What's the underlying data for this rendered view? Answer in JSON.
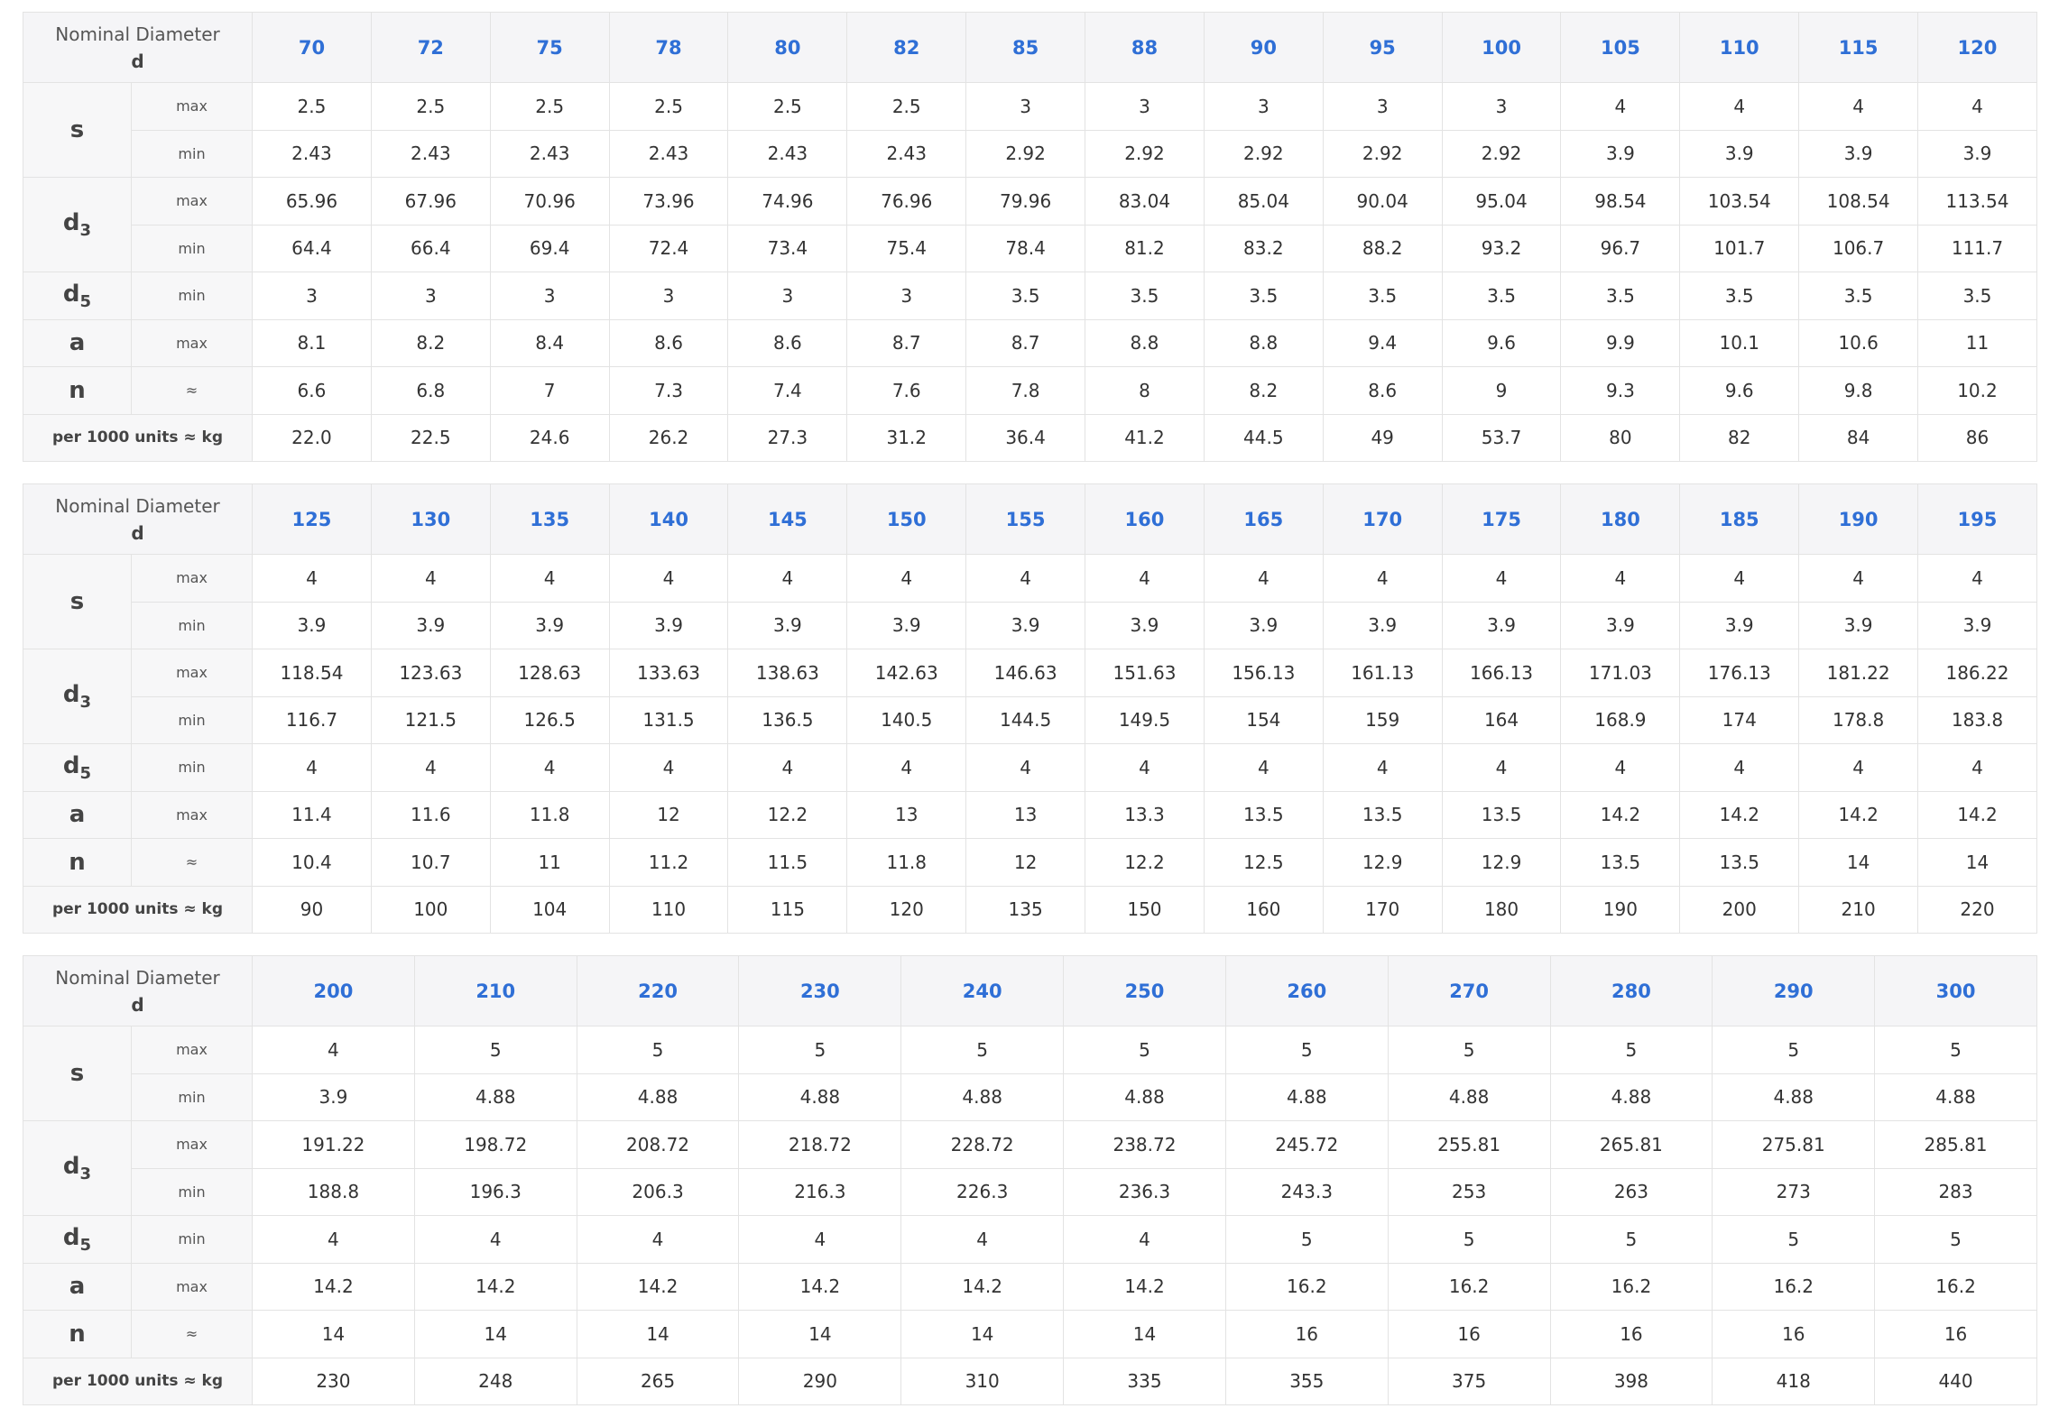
{
  "labels": {
    "nominal_line1": "Nominal Diameter",
    "nominal_line2": "d",
    "weight": "per 1000 units ≈ kg"
  },
  "params": [
    {
      "base": "s",
      "sub": "",
      "rows": [
        "max",
        "min"
      ]
    },
    {
      "base": "d",
      "sub": "3",
      "rows": [
        "max",
        "min"
      ]
    },
    {
      "base": "d",
      "sub": "5",
      "rows": [
        "min"
      ]
    },
    {
      "base": "a",
      "sub": "",
      "rows": [
        "max"
      ]
    },
    {
      "base": "n",
      "sub": "",
      "rows": [
        "≈"
      ]
    }
  ],
  "tables": [
    {
      "sizes": [
        "70",
        "72",
        "75",
        "78",
        "80",
        "82",
        "85",
        "88",
        "90",
        "95",
        "100",
        "105",
        "110",
        "115",
        "120"
      ],
      "rows": [
        [
          "2.5",
          "2.5",
          "2.5",
          "2.5",
          "2.5",
          "2.5",
          "3",
          "3",
          "3",
          "3",
          "3",
          "4",
          "4",
          "4",
          "4"
        ],
        [
          "2.43",
          "2.43",
          "2.43",
          "2.43",
          "2.43",
          "2.43",
          "2.92",
          "2.92",
          "2.92",
          "2.92",
          "2.92",
          "3.9",
          "3.9",
          "3.9",
          "3.9"
        ],
        [
          "65.96",
          "67.96",
          "70.96",
          "73.96",
          "74.96",
          "76.96",
          "79.96",
          "83.04",
          "85.04",
          "90.04",
          "95.04",
          "98.54",
          "103.54",
          "108.54",
          "113.54"
        ],
        [
          "64.4",
          "66.4",
          "69.4",
          "72.4",
          "73.4",
          "75.4",
          "78.4",
          "81.2",
          "83.2",
          "88.2",
          "93.2",
          "96.7",
          "101.7",
          "106.7",
          "111.7"
        ],
        [
          "3",
          "3",
          "3",
          "3",
          "3",
          "3",
          "3.5",
          "3.5",
          "3.5",
          "3.5",
          "3.5",
          "3.5",
          "3.5",
          "3.5",
          "3.5"
        ],
        [
          "8.1",
          "8.2",
          "8.4",
          "8.6",
          "8.6",
          "8.7",
          "8.7",
          "8.8",
          "8.8",
          "9.4",
          "9.6",
          "9.9",
          "10.1",
          "10.6",
          "11"
        ],
        [
          "6.6",
          "6.8",
          "7",
          "7.3",
          "7.4",
          "7.6",
          "7.8",
          "8",
          "8.2",
          "8.6",
          "9",
          "9.3",
          "9.6",
          "9.8",
          "10.2"
        ],
        [
          "22.0",
          "22.5",
          "24.6",
          "26.2",
          "27.3",
          "31.2",
          "36.4",
          "41.2",
          "44.5",
          "49",
          "53.7",
          "80",
          "82",
          "84",
          "86"
        ]
      ]
    },
    {
      "sizes": [
        "125",
        "130",
        "135",
        "140",
        "145",
        "150",
        "155",
        "160",
        "165",
        "170",
        "175",
        "180",
        "185",
        "190",
        "195"
      ],
      "rows": [
        [
          "4",
          "4",
          "4",
          "4",
          "4",
          "4",
          "4",
          "4",
          "4",
          "4",
          "4",
          "4",
          "4",
          "4",
          "4"
        ],
        [
          "3.9",
          "3.9",
          "3.9",
          "3.9",
          "3.9",
          "3.9",
          "3.9",
          "3.9",
          "3.9",
          "3.9",
          "3.9",
          "3.9",
          "3.9",
          "3.9",
          "3.9"
        ],
        [
          "118.54",
          "123.63",
          "128.63",
          "133.63",
          "138.63",
          "142.63",
          "146.63",
          "151.63",
          "156.13",
          "161.13",
          "166.13",
          "171.03",
          "176.13",
          "181.22",
          "186.22"
        ],
        [
          "116.7",
          "121.5",
          "126.5",
          "131.5",
          "136.5",
          "140.5",
          "144.5",
          "149.5",
          "154",
          "159",
          "164",
          "168.9",
          "174",
          "178.8",
          "183.8"
        ],
        [
          "4",
          "4",
          "4",
          "4",
          "4",
          "4",
          "4",
          "4",
          "4",
          "4",
          "4",
          "4",
          "4",
          "4",
          "4"
        ],
        [
          "11.4",
          "11.6",
          "11.8",
          "12",
          "12.2",
          "13",
          "13",
          "13.3",
          "13.5",
          "13.5",
          "13.5",
          "14.2",
          "14.2",
          "14.2",
          "14.2"
        ],
        [
          "10.4",
          "10.7",
          "11",
          "11.2",
          "11.5",
          "11.8",
          "12",
          "12.2",
          "12.5",
          "12.9",
          "12.9",
          "13.5",
          "13.5",
          "14",
          "14"
        ],
        [
          "90",
          "100",
          "104",
          "110",
          "115",
          "120",
          "135",
          "150",
          "160",
          "170",
          "180",
          "190",
          "200",
          "210",
          "220"
        ]
      ]
    },
    {
      "sizes": [
        "200",
        "210",
        "220",
        "230",
        "240",
        "250",
        "260",
        "270",
        "280",
        "290",
        "300"
      ],
      "rows": [
        [
          "4",
          "5",
          "5",
          "5",
          "5",
          "5",
          "5",
          "5",
          "5",
          "5",
          "5"
        ],
        [
          "3.9",
          "4.88",
          "4.88",
          "4.88",
          "4.88",
          "4.88",
          "4.88",
          "4.88",
          "4.88",
          "4.88",
          "4.88"
        ],
        [
          "191.22",
          "198.72",
          "208.72",
          "218.72",
          "228.72",
          "238.72",
          "245.72",
          "255.81",
          "265.81",
          "275.81",
          "285.81"
        ],
        [
          "188.8",
          "196.3",
          "206.3",
          "216.3",
          "226.3",
          "236.3",
          "243.3",
          "253",
          "263",
          "273",
          "283"
        ],
        [
          "4",
          "4",
          "4",
          "4",
          "4",
          "4",
          "5",
          "5",
          "5",
          "5",
          "5"
        ],
        [
          "14.2",
          "14.2",
          "14.2",
          "14.2",
          "14.2",
          "14.2",
          "16.2",
          "16.2",
          "16.2",
          "16.2",
          "16.2"
        ],
        [
          "14",
          "14",
          "14",
          "14",
          "14",
          "14",
          "16",
          "16",
          "16",
          "16",
          "16"
        ],
        [
          "230",
          "248",
          "265",
          "290",
          "310",
          "335",
          "355",
          "375",
          "398",
          "418",
          "440"
        ]
      ]
    }
  ]
}
